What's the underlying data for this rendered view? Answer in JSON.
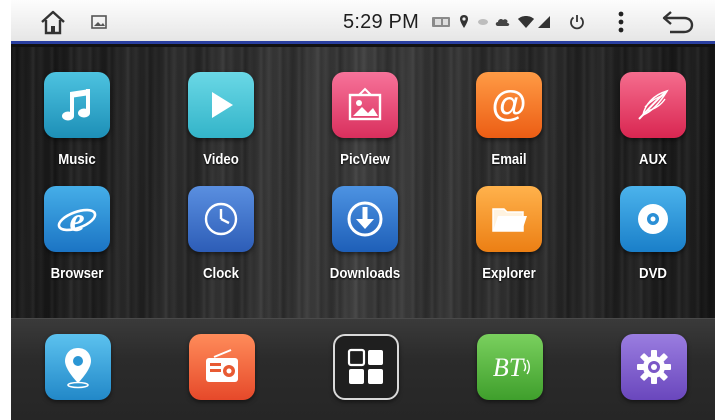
{
  "statusbar": {
    "time": "5:29 PM",
    "icons": [
      "home-icon",
      "gallery-icon",
      "media-card-icon",
      "location-icon",
      "dot-icon",
      "cloud-icon",
      "wifi-icon",
      "signal-icon",
      "power-icon",
      "menu-icon",
      "back-icon"
    ]
  },
  "apps": [
    {
      "label": "Music",
      "icon": "music-note-icon",
      "color": "#2aa2c6"
    },
    {
      "label": "Video",
      "icon": "play-icon",
      "color": "#44c4d6"
    },
    {
      "label": "PicView",
      "icon": "picture-icon",
      "color": "#ec4a78"
    },
    {
      "label": "Email",
      "icon": "at-icon",
      "color": "#f4771f"
    },
    {
      "label": "AUX",
      "icon": "feather-icon",
      "color": "#e9436a"
    },
    {
      "label": "Browser",
      "icon": "browser-e-icon",
      "color": "#2a8fd6"
    },
    {
      "label": "Clock",
      "icon": "clock-icon",
      "color": "#3a72c6"
    },
    {
      "label": "Downloads",
      "icon": "download-icon",
      "color": "#2d77c9"
    },
    {
      "label": "Explorer",
      "icon": "folder-icon",
      "color": "#f39c2a"
    },
    {
      "label": "DVD",
      "icon": "disc-icon",
      "color": "#2e9ad8"
    }
  ],
  "dock": [
    {
      "icon": "navigation-pin-icon",
      "color": "#3aa6dc"
    },
    {
      "icon": "radio-icon",
      "color": "#f16a3a"
    },
    {
      "icon": "app-grid-icon",
      "color": "#2a2a2a"
    },
    {
      "icon": "bluetooth-bt-icon",
      "color": "#4fb33b"
    },
    {
      "icon": "settings-gear-icon",
      "color": "#7b57c7"
    }
  ]
}
